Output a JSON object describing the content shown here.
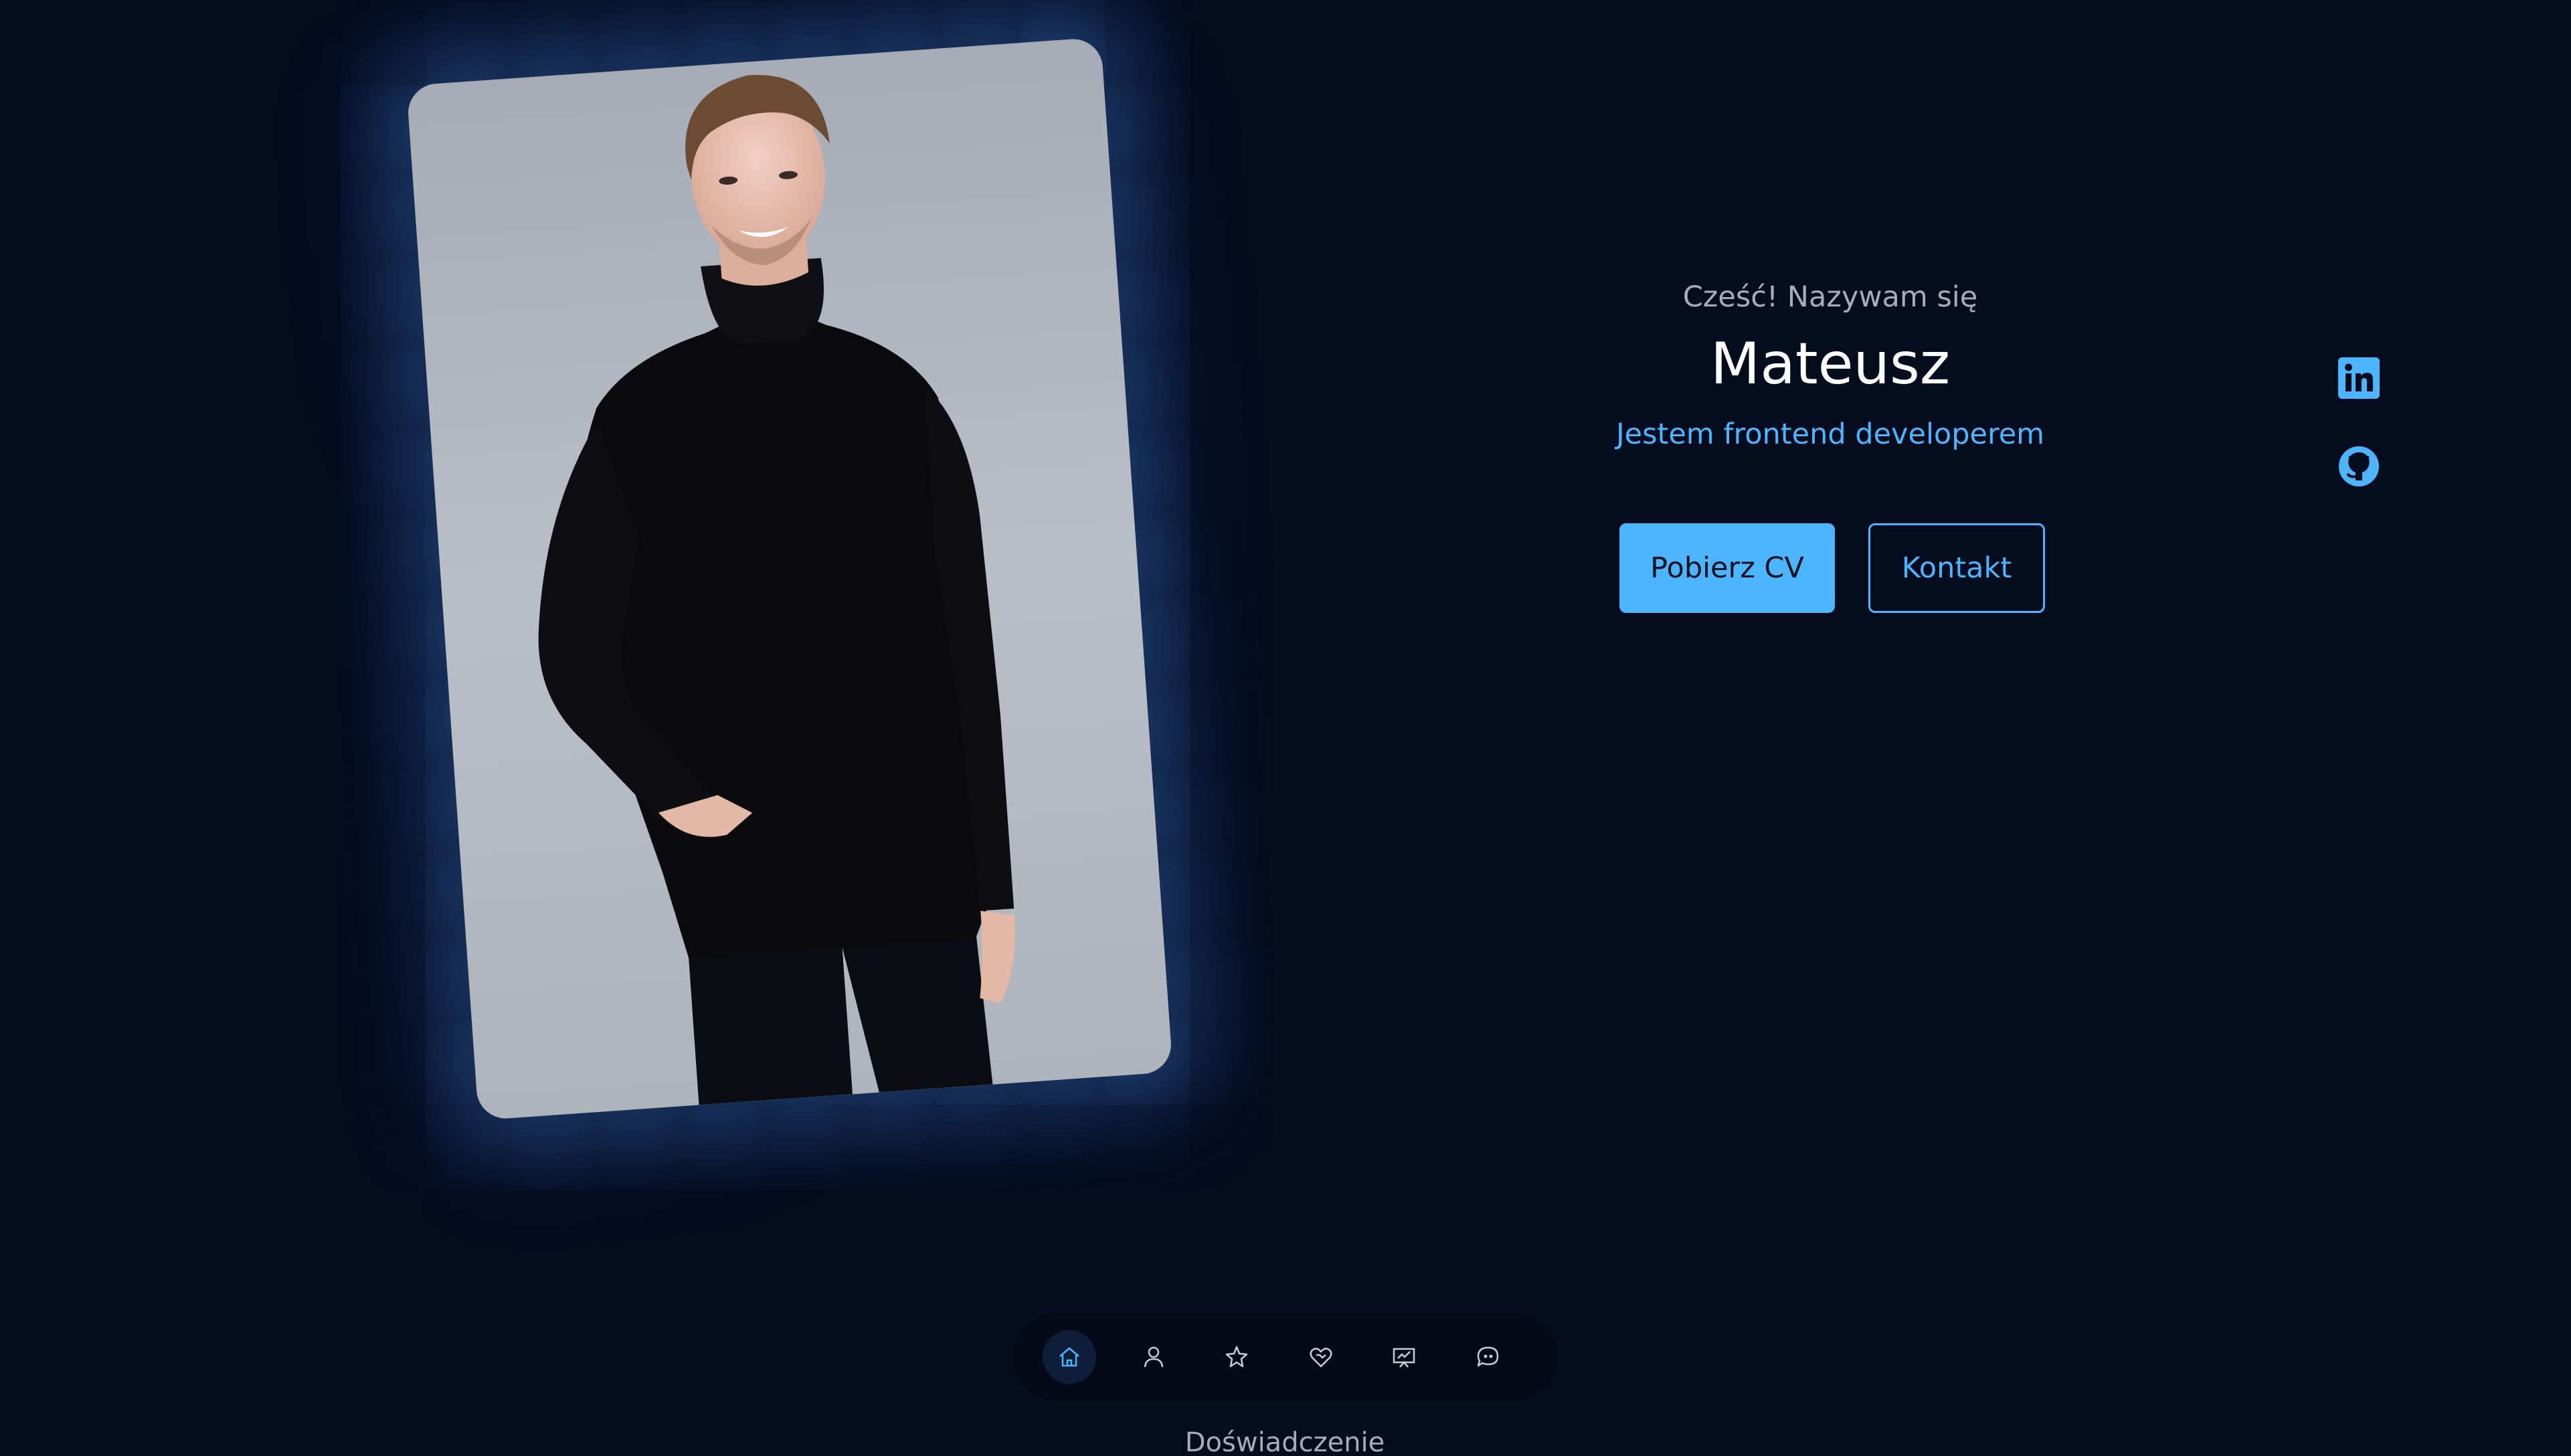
{
  "intro": {
    "greeting": "Cześć! Nazywam się",
    "name": "Mateusz",
    "role": "Jestem frontend developerem"
  },
  "actions": {
    "download_cv": "Pobierz CV",
    "contact": "Kontakt"
  },
  "social": [
    {
      "icon": "linkedin-icon"
    },
    {
      "icon": "github-icon"
    }
  ],
  "nav": {
    "items": [
      {
        "icon": "home-icon",
        "active": true
      },
      {
        "icon": "user-icon",
        "active": false
      },
      {
        "icon": "star-icon",
        "active": false
      },
      {
        "icon": "handshake-heart-icon",
        "active": false
      },
      {
        "icon": "presentation-icon",
        "active": false
      },
      {
        "icon": "chat-quote-icon",
        "active": false
      }
    ]
  },
  "next_section": {
    "heading_peek": "Doświadczenie"
  },
  "colors": {
    "background": "#050c1e",
    "accent": "#4db5ff",
    "text_primary": "#ffffff",
    "text_muted": "#a8acb6"
  }
}
